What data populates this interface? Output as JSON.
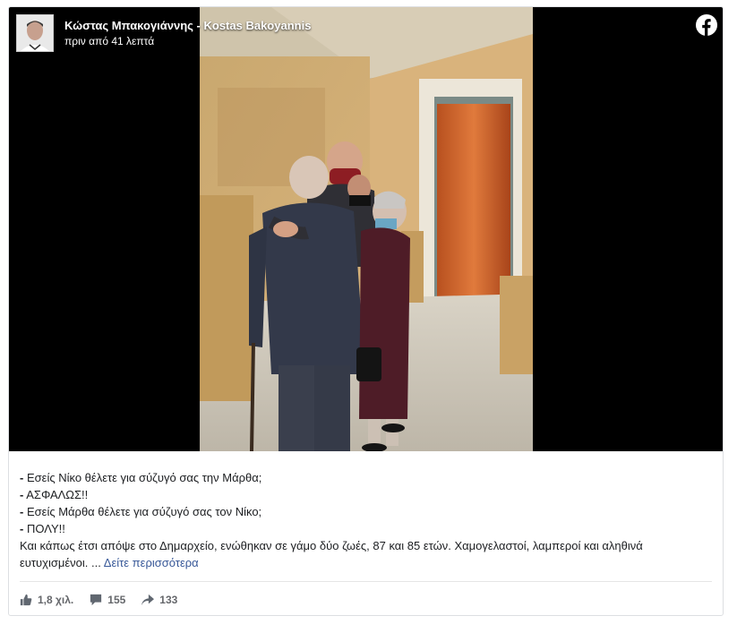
{
  "post": {
    "author": "Κώστας Μπακογιάννης - Kostas Bakoyannis",
    "time": "πριν από 41 λεπτά",
    "lines": [
      {
        "dash": "-",
        "text": " Εσείς Νίκο θέλετε για σύζυγό σας την Μάρθα;"
      },
      {
        "dash": "-",
        "text": " ΑΣΦΑΛΩΣ!!"
      },
      {
        "dash": "-",
        "text": " Εσείς Μάρθα θέλετε για σύζυγό σας τον Νίκο;"
      },
      {
        "dash": "-",
        "text": " ΠΟΛΥ!!"
      }
    ],
    "paragraph": "Και κάπως έτσι απόψε στο Δημαρχείο, ενώθηκαν σε γάμο δύο ζωές, 87 και 85 ετών. Χαμογελαστοί, λαμπεροί και αληθινά ευτυχισμένοι. ...",
    "see_more": "Δείτε περισσότερα"
  },
  "stats": {
    "likes": "1,8 χιλ.",
    "comments": "155",
    "shares": "133"
  },
  "icons": {
    "platform": "facebook-icon",
    "like": "thumbs-up-icon",
    "comment": "comment-bubble-icon",
    "share": "share-arrow-icon"
  },
  "colors": {
    "link": "#385898",
    "meta": "#65676b",
    "text": "#1c1e21"
  }
}
